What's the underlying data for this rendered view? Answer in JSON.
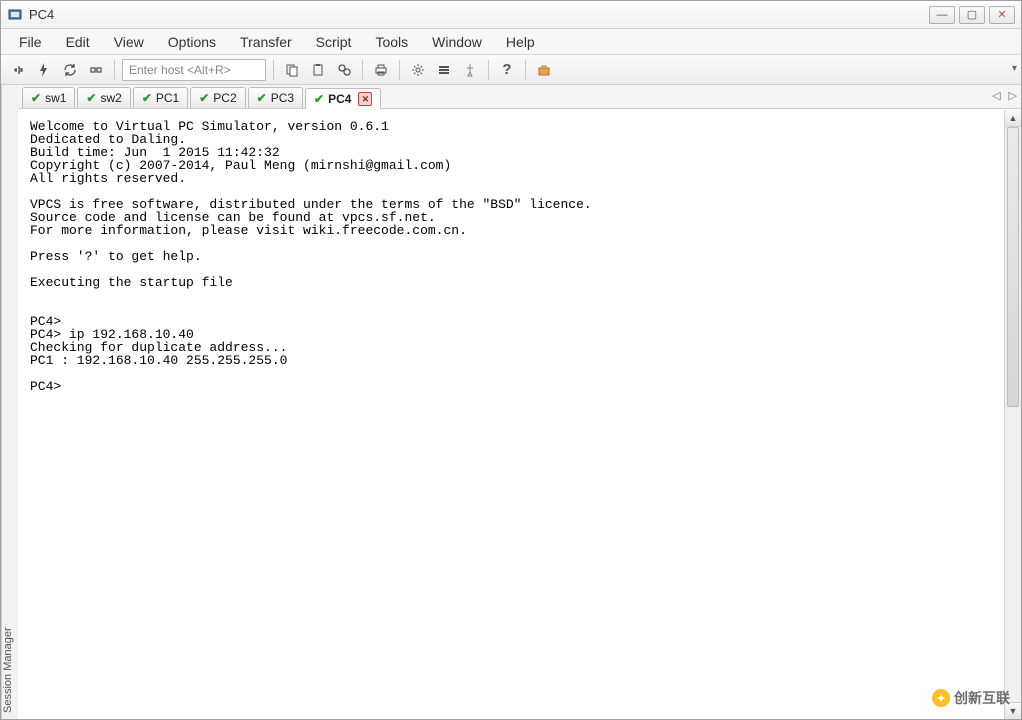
{
  "window": {
    "title": "PC4"
  },
  "menus": [
    "File",
    "Edit",
    "View",
    "Options",
    "Transfer",
    "Script",
    "Tools",
    "Window",
    "Help"
  ],
  "toolbar": {
    "host_placeholder": "Enter host <Alt+R>"
  },
  "side_label": "Session Manager",
  "tabs": [
    {
      "label": "sw1",
      "active": false
    },
    {
      "label": "sw2",
      "active": false
    },
    {
      "label": "PC1",
      "active": false
    },
    {
      "label": "PC2",
      "active": false
    },
    {
      "label": "PC3",
      "active": false
    },
    {
      "label": "PC4",
      "active": true
    }
  ],
  "terminal_text": "Welcome to Virtual PC Simulator, version 0.6.1\nDedicated to Daling.\nBuild time: Jun  1 2015 11:42:32\nCopyright (c) 2007-2014, Paul Meng (mirnshi@gmail.com)\nAll rights reserved.\n\nVPCS is free software, distributed under the terms of the \"BSD\" licence.\nSource code and license can be found at vpcs.sf.net.\nFor more information, please visit wiki.freecode.com.cn.\n\nPress '?' to get help.\n\nExecuting the startup file\n\n\nPC4>\nPC4> ip 192.168.10.40\nChecking for duplicate address...\nPC1 : 192.168.10.40 255.255.255.0\n\nPC4>",
  "watermark": "创新互联"
}
